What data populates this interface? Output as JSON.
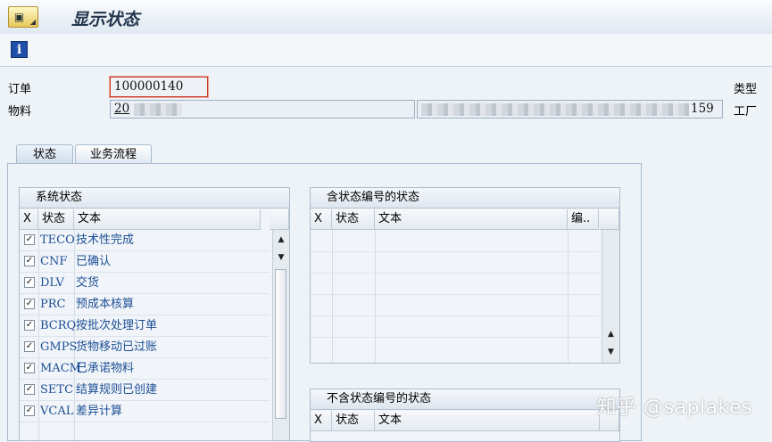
{
  "title": "显示状态",
  "header": {
    "order_label": "订单",
    "order_value": "100000140",
    "material_label": "物料",
    "material_value": "20",
    "material_desc_suffix": "159",
    "type_label": "类型",
    "plant_label": "工厂"
  },
  "tabs": [
    {
      "label": "状态",
      "active": true
    },
    {
      "label": "业务流程",
      "active": false
    }
  ],
  "system_status": {
    "title": "系统状态",
    "columns": [
      "X",
      "状态",
      "文本"
    ],
    "rows": [
      {
        "checked": true,
        "code": "TECO",
        "text": "技术性完成"
      },
      {
        "checked": true,
        "code": "CNF",
        "text": "已确认"
      },
      {
        "checked": true,
        "code": "DLV",
        "text": "交货"
      },
      {
        "checked": true,
        "code": "PRC",
        "text": "预成本核算"
      },
      {
        "checked": true,
        "code": "BCRQ",
        "text": "按批次处理订单"
      },
      {
        "checked": true,
        "code": "GMPS",
        "text": "货物移动已过账"
      },
      {
        "checked": true,
        "code": "MACM",
        "text": "已承诺物料"
      },
      {
        "checked": true,
        "code": "SETC",
        "text": "结算规则已创建"
      },
      {
        "checked": true,
        "code": "VCAL",
        "text": "差异计算"
      }
    ]
  },
  "status_with_number": {
    "title": "含状态编号的状态",
    "columns": [
      "X",
      "状态",
      "文本",
      "编.."
    ]
  },
  "status_without_number": {
    "title": "不含状态编号的状态",
    "columns": [
      "X",
      "状态",
      "文本"
    ]
  },
  "watermark": "知乎 @saplakes",
  "colors": {
    "accent_text": "#1d4f96",
    "background": "#eef3f8"
  },
  "icons": [
    "menu-icon",
    "info-icon",
    "checkbox-icon",
    "scroll-up-icon",
    "scroll-down-icon"
  ]
}
